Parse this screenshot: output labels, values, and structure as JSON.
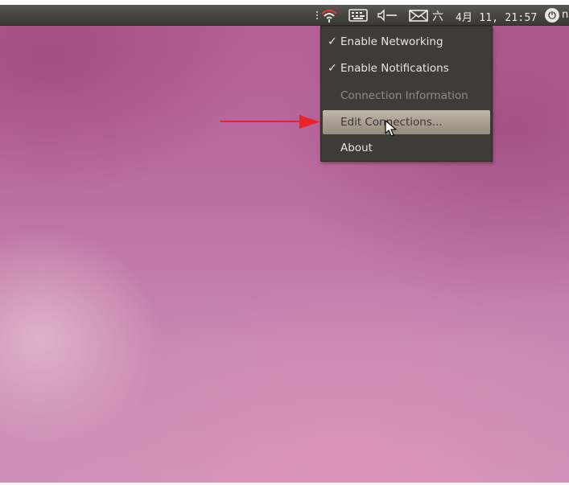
{
  "panel": {
    "tray_icons": [
      "network-wifi-icon",
      "keyboard-icon",
      "volume-icon",
      "mail-icon"
    ],
    "weekday": "六",
    "clock": "4月 11, 21:57",
    "session_icon": "session-icon",
    "user_name": "n"
  },
  "menu": {
    "items": [
      {
        "label": "Enable Networking",
        "checked": "✓",
        "state": "normal"
      },
      {
        "label": "Enable Notifications",
        "checked": "✓",
        "state": "normal"
      },
      {
        "label": "Connection Information",
        "checked": "",
        "state": "disabled"
      },
      {
        "label": "Edit Connections...",
        "checked": "",
        "state": "hover"
      },
      {
        "label": "About",
        "checked": "",
        "state": "normal"
      }
    ]
  },
  "colors": {
    "panel": "#45443f",
    "menu_bg": "#3e3c38",
    "menu_highlight": "#aa9f91",
    "annotation_arrow": "#e8232a",
    "desktop": "#c080aa"
  }
}
